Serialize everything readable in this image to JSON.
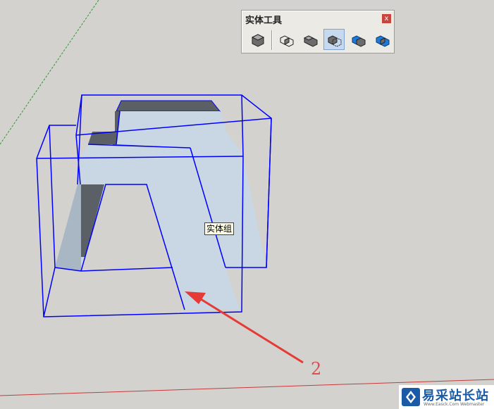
{
  "toolbar": {
    "title": "实体工具",
    "close_glyph": "x",
    "tools": [
      {
        "icon": "outer-shell-icon"
      },
      {
        "icon": "intersect-icon"
      },
      {
        "icon": "union-icon"
      },
      {
        "icon": "subtract-icon",
        "active": true
      },
      {
        "icon": "trim-icon"
      },
      {
        "icon": "split-icon"
      }
    ]
  },
  "tooltip": {
    "text": "实体组"
  },
  "annotation": {
    "number": "2"
  },
  "watermark": {
    "text": "易采站长站",
    "subtext": "Www.Easck.Com Webmaster"
  },
  "colors": {
    "background": "#d3d2cf",
    "selection_box": "#0000ff",
    "face_light": "#c9d6e3",
    "face_dark": "#5b5f66",
    "arrow": "#e53a35",
    "green_axis": "#2e9a2e",
    "red_axis": "#c83a3a"
  }
}
